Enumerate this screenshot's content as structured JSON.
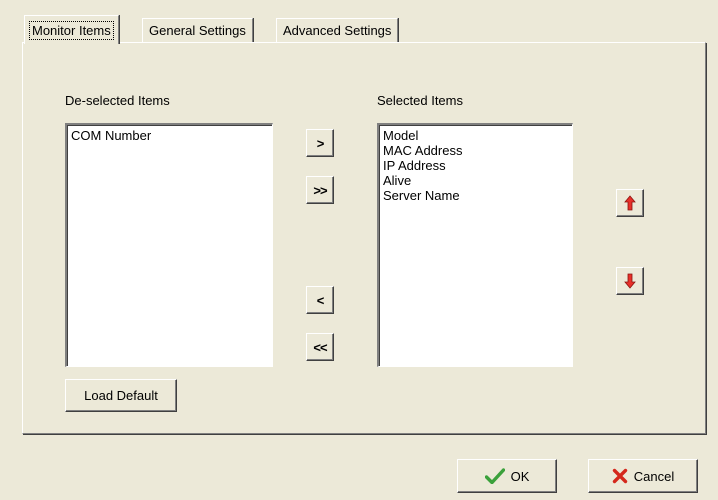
{
  "tabs": [
    {
      "label": "Monitor Items"
    },
    {
      "label": "General Settings"
    },
    {
      "label": "Advanced Settings"
    }
  ],
  "deselected": {
    "label": "De-selected Items",
    "items": [
      "COM Number"
    ]
  },
  "selected": {
    "label": "Selected Items",
    "items": [
      "Model",
      "MAC Address",
      "IP Address",
      "Alive",
      "Server Name"
    ]
  },
  "transfer_buttons": {
    "add_one": ">",
    "add_all": ">>",
    "remove_one": "<",
    "remove_all": "<<"
  },
  "load_default_label": "Load Default",
  "ok_label": "OK",
  "cancel_label": "Cancel",
  "icons": {
    "move_up": "arrow-up-icon",
    "move_down": "arrow-down-icon",
    "ok": "checkmark-icon",
    "cancel": "x-mark-icon"
  },
  "colors": {
    "window_bg": "#ECE9D8",
    "arrow_red": "#E8302A",
    "check_green": "#3BA13B",
    "x_red": "#D4281C"
  }
}
